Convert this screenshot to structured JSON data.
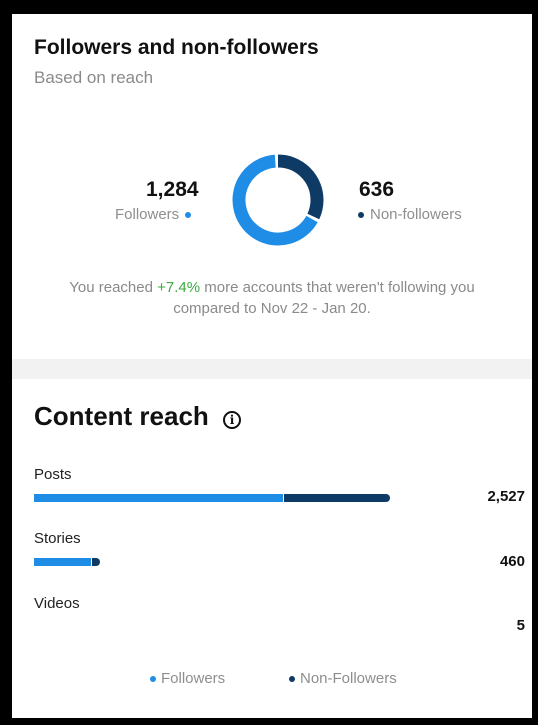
{
  "colors": {
    "followers": "#1f8de6",
    "non_followers": "#0e3a66",
    "positive": "#3bab3f"
  },
  "card": {
    "title": "Followers and non-followers",
    "subtitle": "Based on reach",
    "followers_count": "1,284",
    "followers_label": "Followers",
    "non_followers_count": "636",
    "non_followers_label": "Non-followers",
    "donut": {
      "followers": 1284,
      "non_followers": 636
    },
    "note_prefix": "You reached ",
    "note_change": "+7.4%",
    "note_suffix": " more accounts that weren't following you",
    "note_line2": "compared to Nov 22 - Jan 20."
  },
  "content_reach": {
    "title": "Content reach",
    "info_icon": "info-icon",
    "rows": [
      {
        "label": "Posts",
        "value": "2,527",
        "followers_fraction": 0.7,
        "non_followers_fraction": 0.3,
        "total": 2527
      },
      {
        "label": "Stories",
        "value": "460",
        "followers_fraction": 0.88,
        "non_followers_fraction": 0.12,
        "total": 460
      },
      {
        "label": "Videos",
        "value": "5",
        "followers_fraction": 0,
        "non_followers_fraction": 0,
        "total": 5
      }
    ]
  },
  "legend": {
    "followers": "Followers",
    "non_followers": "Non-Followers"
  }
}
